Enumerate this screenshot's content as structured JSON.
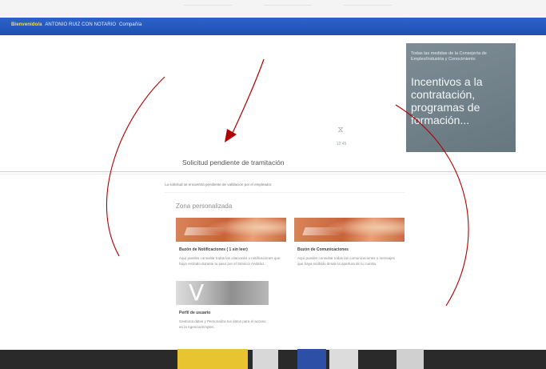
{
  "topbar": {
    "welcome": "Bienvenido/a",
    "user_name": "ANTONIO RUIZ CON NOTARIO",
    "user_extra": "Compañía"
  },
  "banner": {
    "kicker": "Todas las medidas de la Consejería de Empleo/Industria y Conocimiento",
    "headline": "Incentivos a la contratación, programas de formación..."
  },
  "loading": {
    "icon": "hourglass-icon",
    "label": "12:45"
  },
  "page": {
    "title": "Solicitud pendiente de tramitación",
    "notice": "La solicitud se encuentra pendiente de validación por el empleador."
  },
  "personal_zone": {
    "title": "Zona personalizada",
    "cards": [
      {
        "title": "Buzón de Notificaciones ( 1 sin leer)",
        "description": "Aquí puedes consultar todas las citaciones o notificaciones que haya recibido durante tu paso por el Servicio Andaluz.",
        "image": "orange"
      },
      {
        "title": "Buzón de Comunicaciones",
        "description": "Aquí puedes consultar todas las comunicaciones o mensajes que haya recibido desde la apertura de tu cuenta.",
        "image": "orange"
      },
      {
        "title": "Perfil de usuario",
        "description": "Gestiona datos y Personaliza tus datos para el acceso en la Agencia Empleo.",
        "image": "grey"
      }
    ]
  },
  "colors": {
    "topbar": "#1e4fb0",
    "welcome_text": "#f6e04a",
    "banner": "#6f7e87",
    "annotation": "#b00000",
    "footer": "#2a2a2a"
  }
}
